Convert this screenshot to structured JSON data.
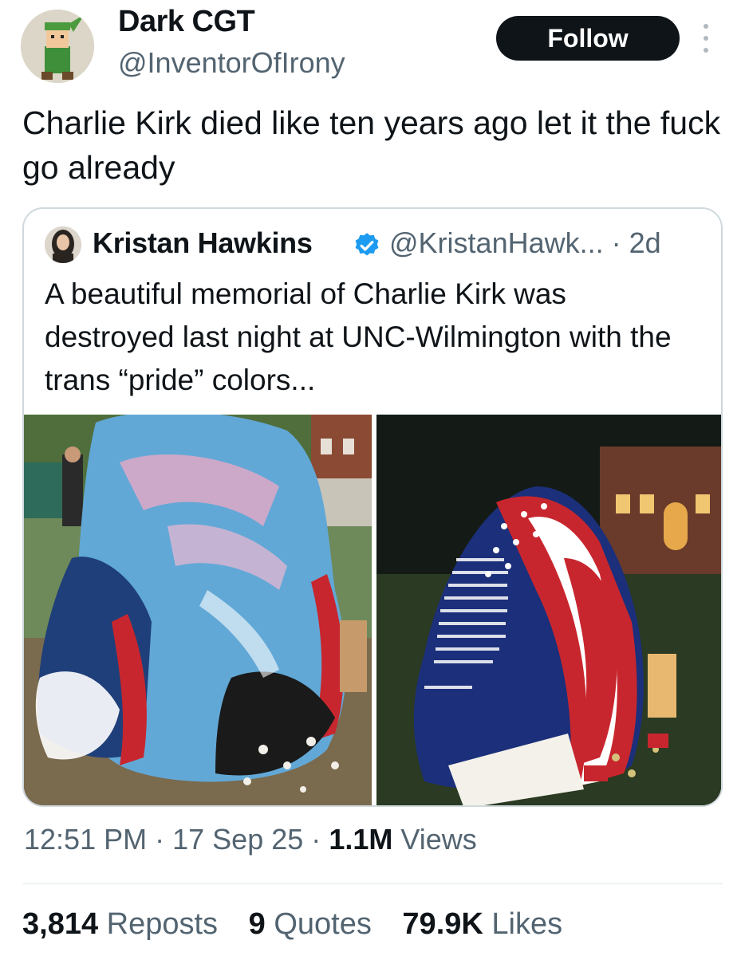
{
  "author": {
    "name": "Dark CGT",
    "handle": "@InventorOfIrony",
    "follow_label": "Follow"
  },
  "tweet": {
    "text": "Charlie Kirk died like ten years ago let it the fuck go already"
  },
  "quoted": {
    "name": "Kristan Hawkins",
    "handle": "@KristanHawk...",
    "age": "· 2d",
    "text": "A beautiful memorial of Charlie Kirk was destroyed last night at UNC-Wilmington with the trans “pride” colors..."
  },
  "meta": {
    "time": "12:51 PM",
    "sep1": "·",
    "date": "17 Sep 25",
    "sep2": "·",
    "views_count": "1.1M",
    "views_label": "Views"
  },
  "stats": {
    "reposts_count": "3,814",
    "reposts_label": "Reposts",
    "quotes_count": "9",
    "quotes_label": "Quotes",
    "likes_count": "79.9K",
    "likes_label": "Likes"
  },
  "colors": {
    "text": "#0f1419",
    "muted": "#536471",
    "verified": "#1d9bf0"
  }
}
